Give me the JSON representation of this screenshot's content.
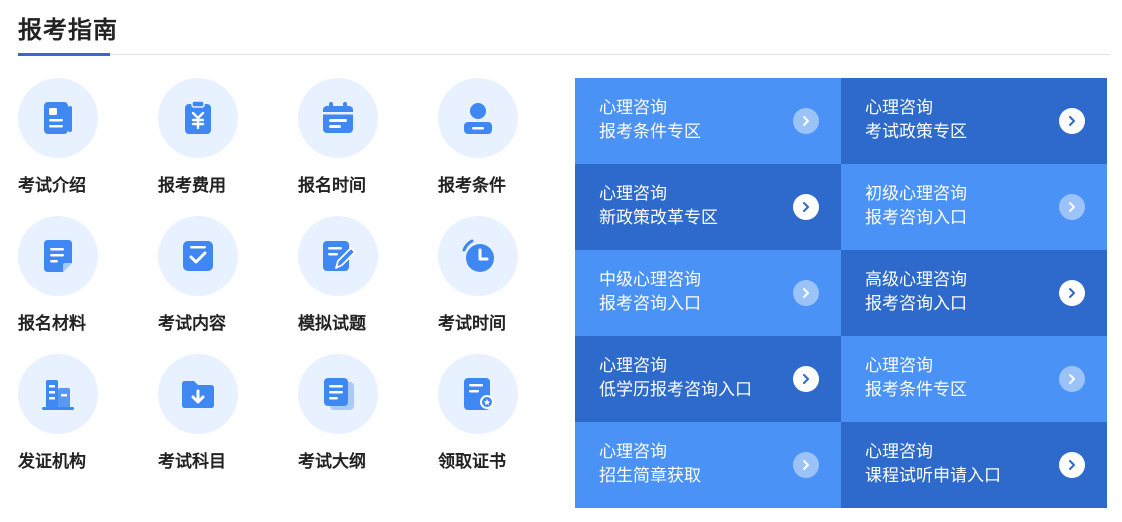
{
  "header": {
    "title": "报考指南"
  },
  "colors": {
    "accent": "#2f6bd0",
    "tile_light": "#4a92f5",
    "tile_dark": "#2d6acb",
    "icon_bg": "#e8f1ff",
    "icon_fg": "#3f87f2"
  },
  "guide_items": [
    {
      "label": "考试介绍",
      "icon": "document-icon"
    },
    {
      "label": "报考费用",
      "icon": "fee-icon"
    },
    {
      "label": "报名时间",
      "icon": "calendar-icon"
    },
    {
      "label": "报考条件",
      "icon": "user-badge-icon"
    },
    {
      "label": "报名材料",
      "icon": "file-icon"
    },
    {
      "label": "考试内容",
      "icon": "checklist-icon"
    },
    {
      "label": "模拟试题",
      "icon": "edit-icon"
    },
    {
      "label": "考试时间",
      "icon": "clock-icon"
    },
    {
      "label": "发证机构",
      "icon": "building-icon"
    },
    {
      "label": "考试科目",
      "icon": "folder-download-icon"
    },
    {
      "label": "考试大纲",
      "icon": "docs-icon"
    },
    {
      "label": "领取证书",
      "icon": "certificate-icon"
    }
  ],
  "link_tiles": [
    {
      "line1": "心理咨询",
      "line2": "报考条件专区",
      "tone": "light"
    },
    {
      "line1": "心理咨询",
      "line2": "考试政策专区",
      "tone": "dark"
    },
    {
      "line1": "心理咨询",
      "line2": "新政策改革专区",
      "tone": "dark"
    },
    {
      "line1": "初级心理咨询",
      "line2": "报考咨询入口",
      "tone": "light"
    },
    {
      "line1": "中级心理咨询",
      "line2": "报考咨询入口",
      "tone": "light"
    },
    {
      "line1": "高级心理咨询",
      "line2": "报考咨询入口",
      "tone": "dark"
    },
    {
      "line1": "心理咨询",
      "line2": "低学历报考咨询入口",
      "tone": "dark"
    },
    {
      "line1": "心理咨询",
      "line2": "报考条件专区",
      "tone": "light"
    },
    {
      "line1": "心理咨询",
      "line2": "招生简章获取",
      "tone": "light"
    },
    {
      "line1": "心理咨询",
      "line2": "课程试听申请入口",
      "tone": "dark"
    }
  ]
}
